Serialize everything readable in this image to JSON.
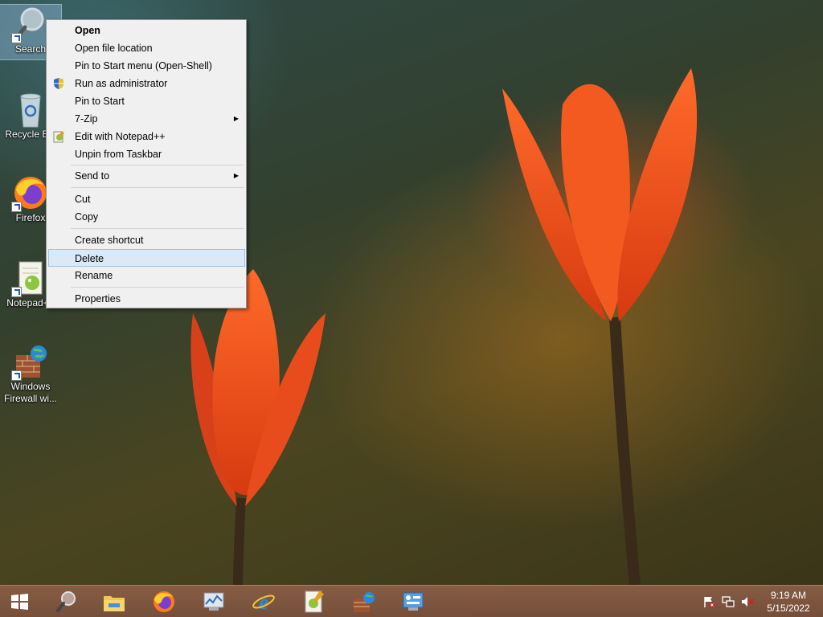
{
  "desktop": {
    "icons": [
      {
        "label": "Search",
        "icon": "magnifier-icon"
      },
      {
        "label": "Recycle Bin",
        "icon": "recycle-bin-icon"
      },
      {
        "label": "Firefox",
        "icon": "firefox-icon"
      },
      {
        "label": "Notepad++",
        "icon": "notepadpp-icon"
      },
      {
        "label": "Windows\nFirewall wi...",
        "icon": "firewall-icon"
      }
    ]
  },
  "context_menu": {
    "items": {
      "open": "Open",
      "open_file_location": "Open file location",
      "pin_start_menu": "Pin to Start menu (Open-Shell)",
      "run_as_admin": "Run as administrator",
      "pin_to_start": "Pin to Start",
      "seven_zip": "7-Zip",
      "edit_notepadpp": "Edit with Notepad++",
      "unpin_taskbar": "Unpin from Taskbar",
      "send_to": "Send to",
      "cut": "Cut",
      "copy": "Copy",
      "create_shortcut": "Create shortcut",
      "delete": "Delete",
      "rename": "Rename",
      "properties": "Properties"
    },
    "highlighted": "delete"
  },
  "taskbar": {
    "pinned": [
      "start-icon",
      "search-icon",
      "file-explorer-icon",
      "firefox-icon",
      "resource-monitor-icon",
      "internet-explorer-icon",
      "notepadpp-icon",
      "firewall-icon",
      "control-panel-icon"
    ],
    "clock": {
      "time": "9:19 AM",
      "date": "5/15/2022"
    }
  },
  "colors": {
    "menu_highlight": "#dbe9f7",
    "taskbar": "#8c5f46"
  }
}
